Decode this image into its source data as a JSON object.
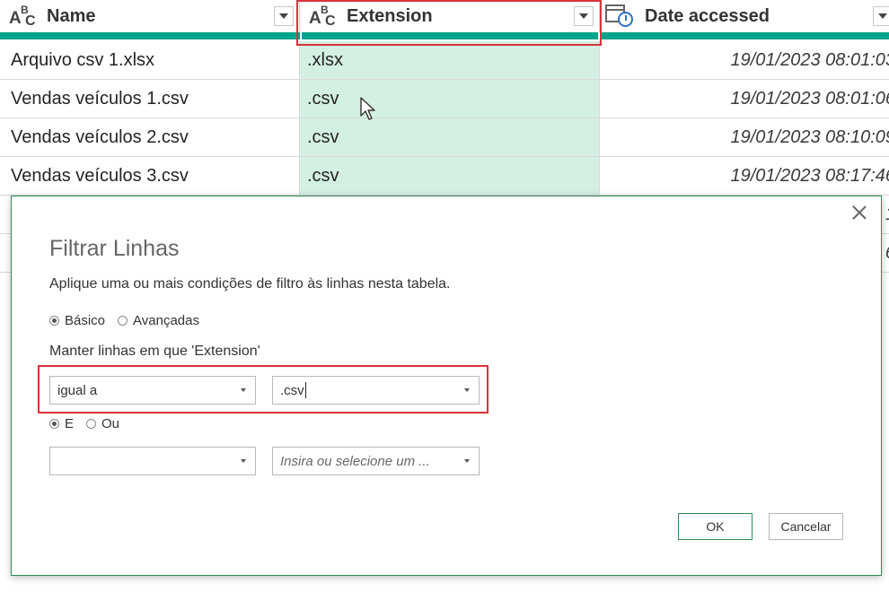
{
  "grid": {
    "columns": [
      {
        "label": "Name",
        "type_icon": "abc-type-icon"
      },
      {
        "label": "Extension",
        "type_icon": "abc-type-icon"
      },
      {
        "label": "Date accessed",
        "type_icon": "datetime-type-icon"
      }
    ],
    "rows": [
      {
        "name": "Arquivo csv 1.xlsx",
        "ext": ".xlsx",
        "date": "19/01/2023 08:01:03"
      },
      {
        "name": "Vendas veículos 1.csv",
        "ext": ".csv",
        "date": "19/01/2023 08:01:06"
      },
      {
        "name": "Vendas veículos 2.csv",
        "ext": ".csv",
        "date": "19/01/2023 08:10:09"
      },
      {
        "name": "Vendas veículos 3.csv",
        "ext": ".csv",
        "date": "19/01/2023 08:17:46"
      }
    ],
    "partial_rows": [
      {
        "date_tail": "1"
      },
      {
        "date_tail": "6"
      }
    ],
    "colors": {
      "accent_bar": "#00a58a",
      "selected_column": "#d3f0e2",
      "highlight": "#d9333b"
    }
  },
  "dialog": {
    "title": "Filtrar Linhas",
    "description": "Aplique uma ou mais condições de filtro às linhas nesta tabela.",
    "mode": {
      "basic": "Básico",
      "advanced": "Avançadas",
      "selected": "basic"
    },
    "keep_label": "Manter linhas em que 'Extension'",
    "condition1": {
      "operator": "igual a",
      "value": ".csv"
    },
    "logic": {
      "and": "E",
      "or": "Ou",
      "selected": "and"
    },
    "condition2": {
      "operator": "",
      "value_placeholder": "Insira ou selecione um ..."
    },
    "ok": "OK",
    "cancel": "Cancelar"
  }
}
